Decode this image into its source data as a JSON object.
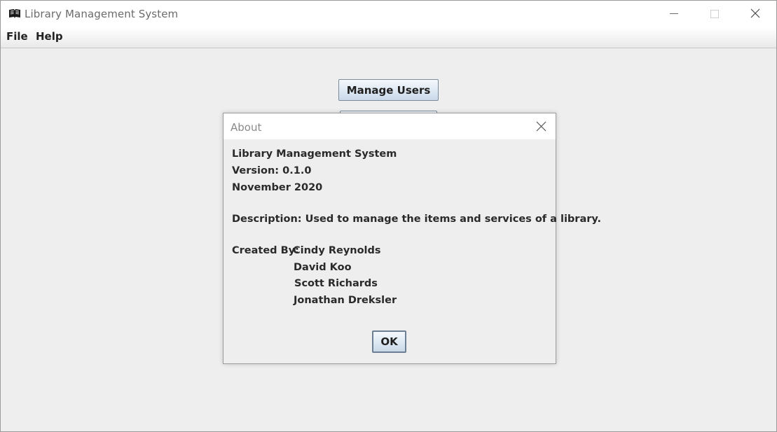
{
  "window": {
    "title": "Library Management System",
    "icon": "open-book-icon",
    "controls": [
      "minimize-icon",
      "maximize-icon",
      "close-icon"
    ]
  },
  "menubar": {
    "file_label": "File",
    "help_label": "Help"
  },
  "main": {
    "manage_users_label": "Manage Users",
    "second_button_label": ""
  },
  "about_dialog": {
    "title": "About",
    "app_name": "Library Management System",
    "version": "Version: 0.1.0",
    "date": "November 2020",
    "description": "Description: Used to manage the items and services of a library.",
    "created_by_prefix": "Created By:",
    "authors": [
      "Cindy Reynolds",
      "David Koo",
      "Scott Richards",
      "Jonathan Dreksler"
    ],
    "ok_label": "OK"
  },
  "colors": {
    "window_background": "#eeeeee",
    "titlebar_background": "#ffffff",
    "button_border": "#7a8a99"
  }
}
